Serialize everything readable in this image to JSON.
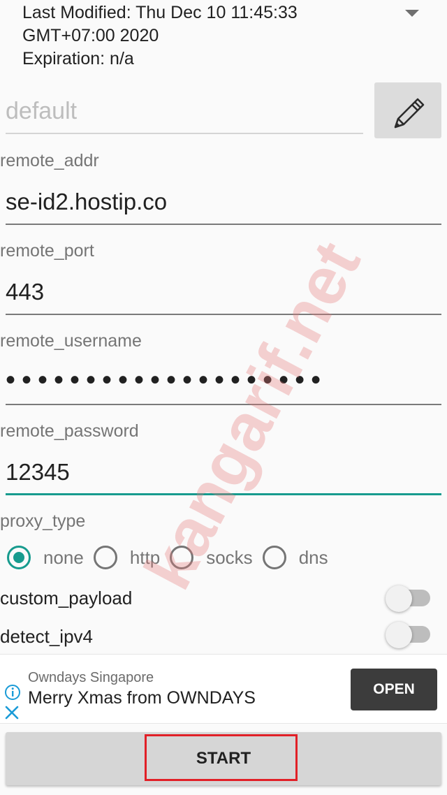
{
  "header": {
    "line1": "Last Modified: Thu Dec 10 11:45:33",
    "line2": "GMT+07:00 2020",
    "line3": "Expiration: n/a"
  },
  "profile": {
    "placeholder": "default"
  },
  "fields": {
    "remote_addr": {
      "label": "remote_addr",
      "value": "se-id2.hostip.co"
    },
    "remote_port": {
      "label": "remote_port",
      "value": "443"
    },
    "remote_username": {
      "label": "remote_username",
      "masked": "••••••••••••••••••••"
    },
    "remote_password": {
      "label": "remote_password",
      "value": "12345"
    }
  },
  "proxy_type": {
    "label": "proxy_type",
    "options": [
      "none",
      "http",
      "socks",
      "dns"
    ],
    "selected": "none"
  },
  "switches": {
    "custom_payload": {
      "label": "custom_payload",
      "on": false
    },
    "detect_ipv4": {
      "label": "detect_ipv4",
      "on": false
    }
  },
  "ad": {
    "advertiser": "Owndays Singapore",
    "headline": "Merry Xmas from OWNDAYS",
    "cta": "OPEN"
  },
  "actions": {
    "start_label": "START"
  },
  "watermark": "kangarif.net",
  "colors": {
    "accent": "#179b8e",
    "highlight": "#e12027"
  }
}
